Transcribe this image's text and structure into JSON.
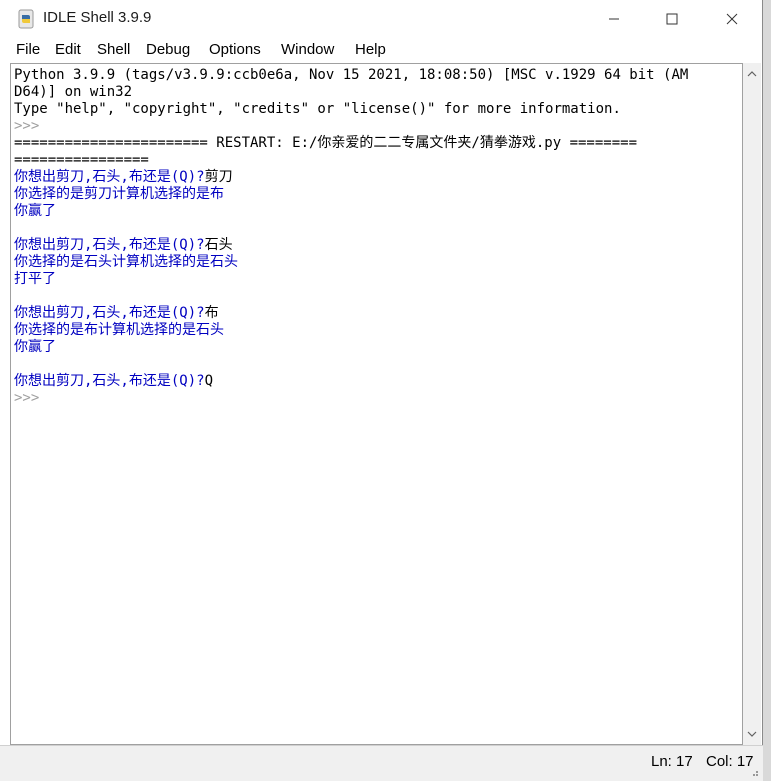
{
  "window": {
    "title": "IDLE Shell 3.9.9"
  },
  "menubar": {
    "items": [
      "File",
      "Edit",
      "Shell",
      "Debug",
      "Options",
      "Window",
      "Help"
    ]
  },
  "shell": {
    "lines": [
      {
        "text": "Python 3.9.9 (tags/v3.9.9:ccb0e6a, Nov 15 2021, 18:08:50) [MSC v.1929 64 bit (AM",
        "kind": "plain"
      },
      {
        "text": "D64)] on win32",
        "kind": "plain"
      },
      {
        "text": "Type \"help\", \"copyright\", \"credits\" or \"license()\" for more information.",
        "kind": "plain"
      },
      {
        "text": ">>>",
        "kind": "prompt"
      },
      {
        "text": "======================= RESTART: E:/你亲爱的二二专属文件夹/猜拳游戏.py ========",
        "kind": "plain"
      },
      {
        "text": "================",
        "kind": "plain"
      },
      {
        "text": "你想出剪刀,石头,布还是(Q)?",
        "kind": "stdout",
        "input": "剪刀"
      },
      {
        "text": "你选择的是剪刀计算机选择的是布",
        "kind": "stdout"
      },
      {
        "text": "你赢了",
        "kind": "stdout"
      },
      {
        "text": "",
        "kind": "stdout"
      },
      {
        "text": "你想出剪刀,石头,布还是(Q)?",
        "kind": "stdout",
        "input": "石头"
      },
      {
        "text": "你选择的是石头计算机选择的是石头",
        "kind": "stdout"
      },
      {
        "text": "打平了",
        "kind": "stdout"
      },
      {
        "text": "",
        "kind": "stdout"
      },
      {
        "text": "你想出剪刀,石头,布还是(Q)?",
        "kind": "stdout",
        "input": "布"
      },
      {
        "text": "你选择的是布计算机选择的是石头",
        "kind": "stdout"
      },
      {
        "text": "你赢了",
        "kind": "stdout"
      },
      {
        "text": "",
        "kind": "stdout"
      },
      {
        "text": "你想出剪刀,石头,布还是(Q)?",
        "kind": "stdout",
        "input": "Q"
      },
      {
        "text": ">>>",
        "kind": "prompt"
      }
    ]
  },
  "status": {
    "ln": "Ln: 17",
    "col": "Col: 17"
  },
  "colors": {
    "stdout": "#0000c0",
    "prompt": "#a0a0a0",
    "text": "#000000"
  }
}
